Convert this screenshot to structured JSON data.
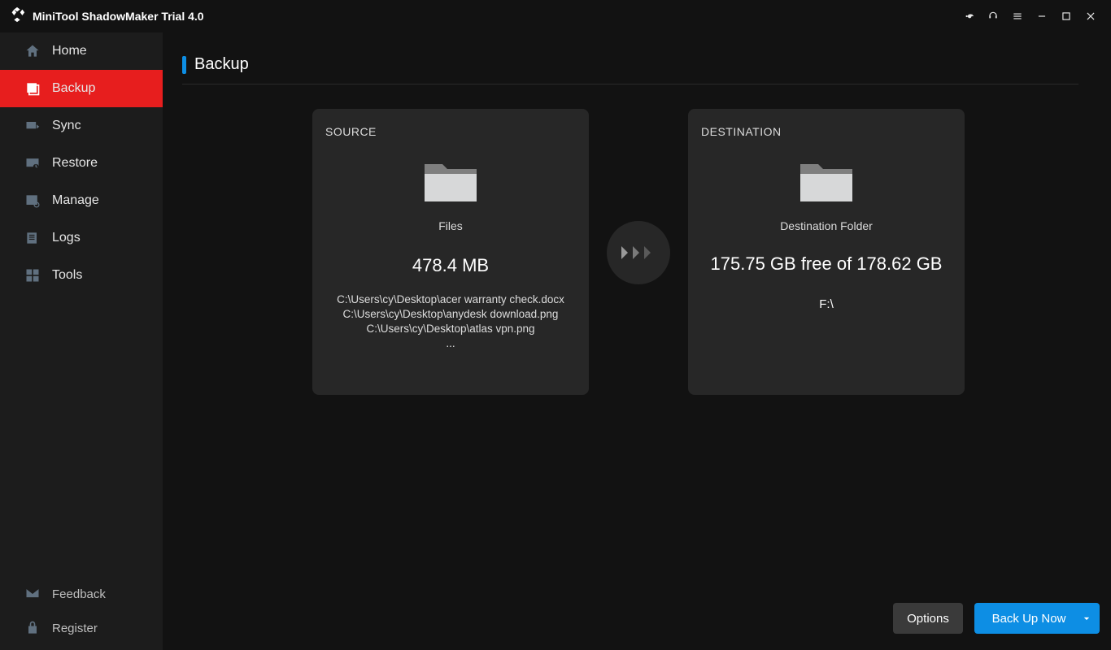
{
  "app_title": "MiniTool ShadowMaker Trial 4.0",
  "sidebar": {
    "items": [
      {
        "label": "Home",
        "icon": "home"
      },
      {
        "label": "Backup",
        "icon": "backup"
      },
      {
        "label": "Sync",
        "icon": "sync"
      },
      {
        "label": "Restore",
        "icon": "restore"
      },
      {
        "label": "Manage",
        "icon": "manage"
      },
      {
        "label": "Logs",
        "icon": "logs"
      },
      {
        "label": "Tools",
        "icon": "tools"
      }
    ],
    "footer": [
      {
        "label": "Feedback",
        "icon": "feedback"
      },
      {
        "label": "Register",
        "icon": "register"
      }
    ]
  },
  "page": {
    "title": "Backup"
  },
  "source": {
    "label": "SOURCE",
    "type": "Files",
    "size": "478.4 MB",
    "paths": [
      "C:\\Users\\cy\\Desktop\\acer warranty check.docx",
      "C:\\Users\\cy\\Desktop\\anydesk download.png",
      "C:\\Users\\cy\\Desktop\\atlas vpn.png",
      "..."
    ]
  },
  "destination": {
    "label": "DESTINATION",
    "type": "Destination Folder",
    "space": "175.75 GB free of 178.62 GB",
    "path": "F:\\"
  },
  "actions": {
    "options": "Options",
    "backup_now": "Back Up Now"
  }
}
